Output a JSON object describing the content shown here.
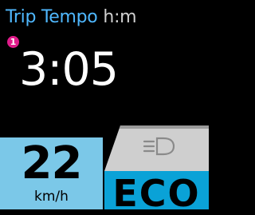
{
  "field": {
    "title": "Trip Tempo",
    "unit": "h:m",
    "badge": "1",
    "value": "3:05"
  },
  "speed": {
    "value": "22",
    "unit": "km/h"
  },
  "assist": {
    "light_icon": "headlight-icon",
    "mode": "ECO"
  },
  "colors": {
    "title_blue": "#4fb8ff",
    "badge_magenta": "#e01b8a",
    "speed_bg": "#7bc8e8",
    "mode_bg": "#0aa2d7",
    "light_bg": "#cfcfcf"
  }
}
